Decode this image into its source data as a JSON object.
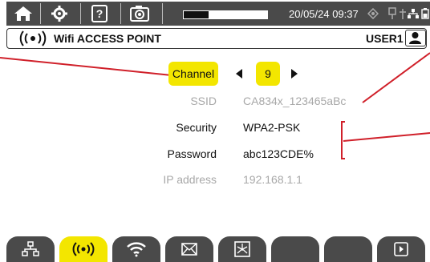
{
  "status_bar": {
    "icons": [
      "home-icon",
      "settings-gear-icon",
      "help-icon",
      "camera-icon"
    ],
    "battery_level": 0.3,
    "datetime": "20/05/24 09:37",
    "right_icons": [
      "gps-icon",
      "usb-icon",
      "network-icon",
      "battery-status-icon"
    ]
  },
  "title_bar": {
    "icon": "wifi-access-point-icon",
    "title": "Wifi ACCESS POINT",
    "user": "USER1",
    "user_icon": "user-icon"
  },
  "form": {
    "channel_label": "Channel",
    "channel_value": "9",
    "ssid_label": "SSID",
    "ssid_value": "CA834x_123465aBc",
    "security_label": "Security",
    "security_value": "WPA2-PSK",
    "password_label": "Password",
    "password_value": "abc123CDE%",
    "ip_label": "IP address",
    "ip_value": "192.168.1.1"
  },
  "tabs": [
    {
      "icon": "ethernet-network-icon",
      "active": false
    },
    {
      "icon": "wifi-access-point-icon",
      "active": true
    },
    {
      "icon": "wifi-icon",
      "active": false
    },
    {
      "icon": "email-icon",
      "active": false
    },
    {
      "icon": "network-diagram-icon",
      "active": false
    },
    {
      "icon": "",
      "active": false
    },
    {
      "icon": "",
      "active": false
    },
    {
      "icon": "play-next-icon",
      "active": false
    }
  ],
  "colors": {
    "accent": "#f3e600",
    "bar": "#4a4a4a",
    "callout": "#d0202a"
  }
}
